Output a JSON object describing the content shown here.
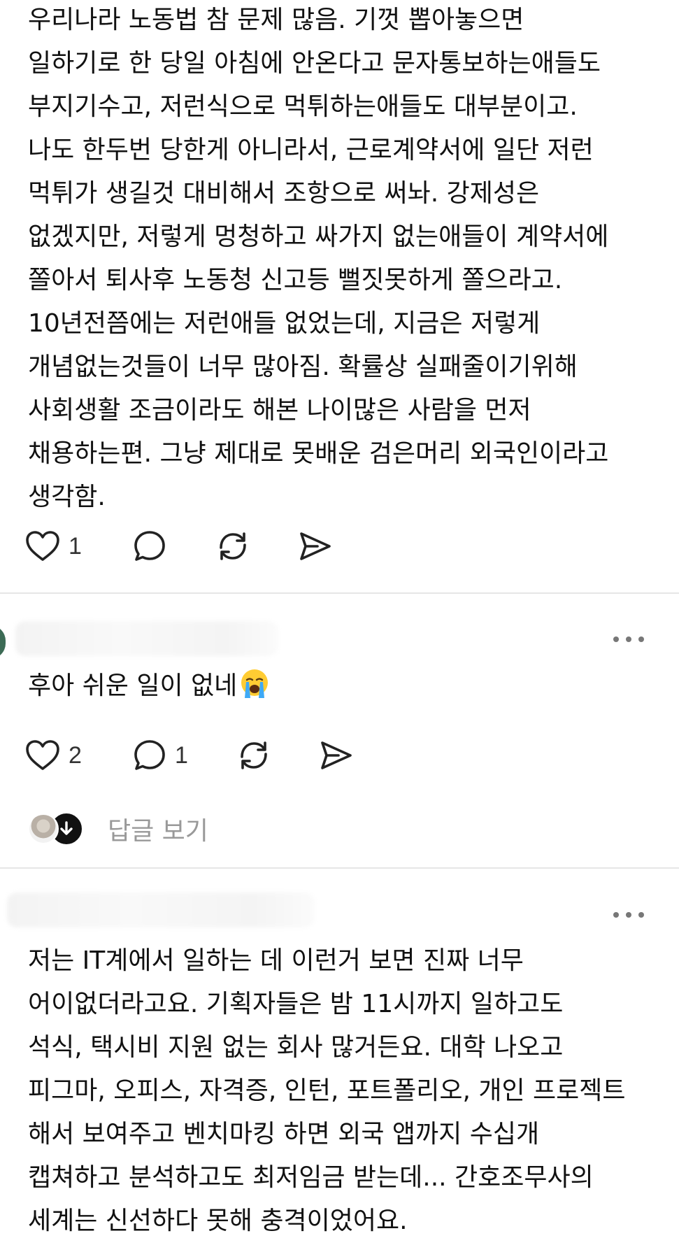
{
  "post1": {
    "text": "우리나라 노동법 참 문제 많음. 기껏 뽑아놓으면\n일하기로 한 당일 아침에 안온다고 문자통보하는애들도\n부지기수고, 저런식으로 먹튀하는애들도 대부분이고.\n나도 한두번 당한게 아니라서, 근로계약서에 일단 저런\n먹튀가 생길것 대비해서 조항으로 써놔. 강제성은\n없겠지만, 저렇게 멍청하고 싸가지 없는애들이 계약서에\n쫄아서 퇴사후 노동청 신고등 뻘짓못하게 쫄으라고.\n10년전쯤에는 저런애들 없었는데, 지금은 저렇게\n개념없는것들이 너무 많아짐. 확률상 실패줄이기위해\n사회생활 조금이라도 해본 나이많은 사람을 먼저\n채용하는편. 그냥 제대로 못배운 검은머리 외국인이라고\n생각함.",
    "like_count": "1",
    "comment_count": "",
    "icons": [
      "heart-icon",
      "comment-icon",
      "repost-icon",
      "share-icon"
    ]
  },
  "post2": {
    "text": "후아 쉬운 일이 없네",
    "emoji": "crying-face-emoji",
    "like_count": "2",
    "comment_count": "1",
    "icons": [
      "heart-icon",
      "comment-icon",
      "repost-icon",
      "share-icon",
      "more-icon"
    ],
    "view_replies_label": "답글 보기"
  },
  "post3": {
    "text": "저는 IT계에서 일하는 데 이런거 보면 진짜 너무\n어이없더라고요. 기획자들은 밤 11시까지 일하고도\n석식, 택시비 지원 없는 회사 많거든요. 대학 나오고\n피그마, 오피스, 자격증, 인턴, 포트폴리오, 개인 프로젝트\n해서 보여주고 벤치마킹 하면 외국 앱까지 수십개\n캡쳐하고 분석하고도 최저임금 받는데... 간호조무사의\n세계는 신선하다 못해 충격이었어요.",
    "icons": [
      "more-icon"
    ]
  },
  "colors": {
    "text": "#111111",
    "muted": "#999999",
    "icon": "#222222",
    "divider": "#e6e6e6"
  }
}
